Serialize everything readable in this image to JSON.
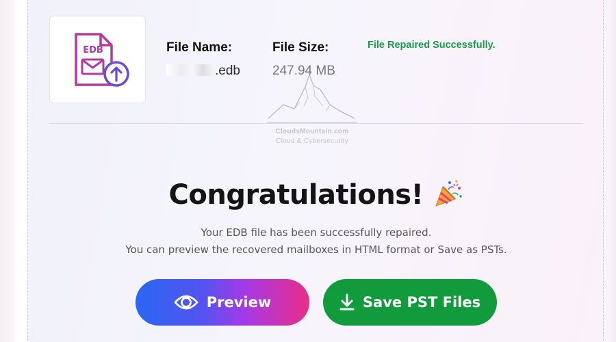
{
  "file_info": {
    "thumbnail_label": "EDB",
    "name_label": "File Name:",
    "name_value": ".edb",
    "size_label": "File Size:",
    "size_value": "247.94 MB",
    "status": "File Repaired Successfully."
  },
  "watermark": {
    "line1": "CloudsMountain.com",
    "line2": "Cloud & Cybersecurity"
  },
  "success": {
    "title": "Congratulations!",
    "line1": "Your EDB file has been successfully repaired.",
    "line2": "You can preview the recovered mailboxes in HTML format or Save as PSTs."
  },
  "actions": {
    "preview_label": "Preview",
    "save_label": "Save PST Files"
  },
  "icons": {
    "file": "edb-file-upload-icon",
    "party": "party-popper-icon",
    "preview": "eye-icon",
    "save": "download-icon"
  },
  "colors": {
    "status_green": "#1a9a4a",
    "save_button": "#129b3d",
    "preview_gradient_start": "#2a66f2",
    "preview_gradient_end": "#ea2d87",
    "edb_icon_magenta": "#b13aa0",
    "upload_badge_purple": "#6a4bd8"
  }
}
